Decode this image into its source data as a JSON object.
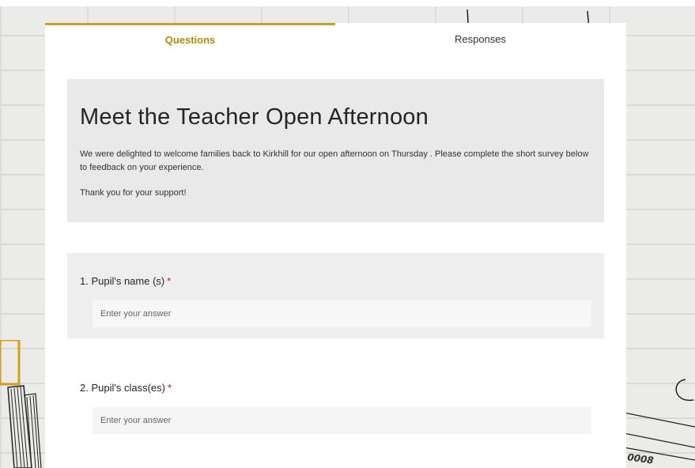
{
  "tabs": {
    "questions": "Questions",
    "responses": "Responses"
  },
  "form": {
    "title": "Meet the Teacher Open Afternoon",
    "description": "We were delighted to welcome families back to Kirkhill for our open afternoon on Thursday . Please complete the short survey below to feedback on your experience.",
    "thanks": "Thank you for your support!"
  },
  "questions": [
    {
      "label": "1. Pupil's name (s)",
      "required_mark": "*",
      "placeholder": "Enter your answer"
    },
    {
      "label": "2. Pupil's class(es)",
      "required_mark": "*",
      "placeholder": "Enter your answer"
    }
  ],
  "background": {
    "doodle_text": "0008"
  },
  "colors": {
    "accent": "#c9a227",
    "tab_active_text": "#b08a09",
    "required": "#a4262c",
    "card_bg": "#e9e9e9"
  }
}
